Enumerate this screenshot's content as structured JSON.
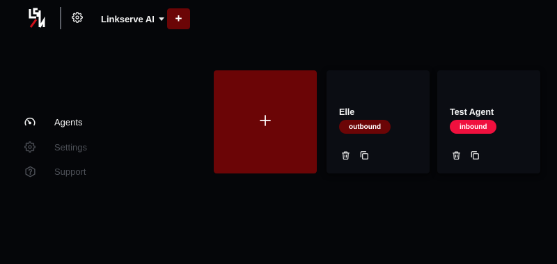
{
  "header": {
    "workspace_name": "Linkserve AI",
    "add_label": "+"
  },
  "sidebar": {
    "items": [
      {
        "label": "Agents",
        "icon": "gauge-icon",
        "active": true
      },
      {
        "label": "Settings",
        "icon": "gear-icon",
        "active": false
      },
      {
        "label": "Support",
        "icon": "question-hexagon-icon",
        "active": false
      }
    ]
  },
  "main": {
    "add_card_label": "+",
    "agents": [
      {
        "name": "Elle",
        "type": "outbound",
        "badge_color": "#6b0506"
      },
      {
        "name": "Test Agent",
        "type": "inbound",
        "badge_color": "#f0103e"
      }
    ]
  },
  "colors": {
    "background": "#050609",
    "accent": "#6b0506",
    "inbound": "#f0103e",
    "card": "#0b0d13"
  }
}
